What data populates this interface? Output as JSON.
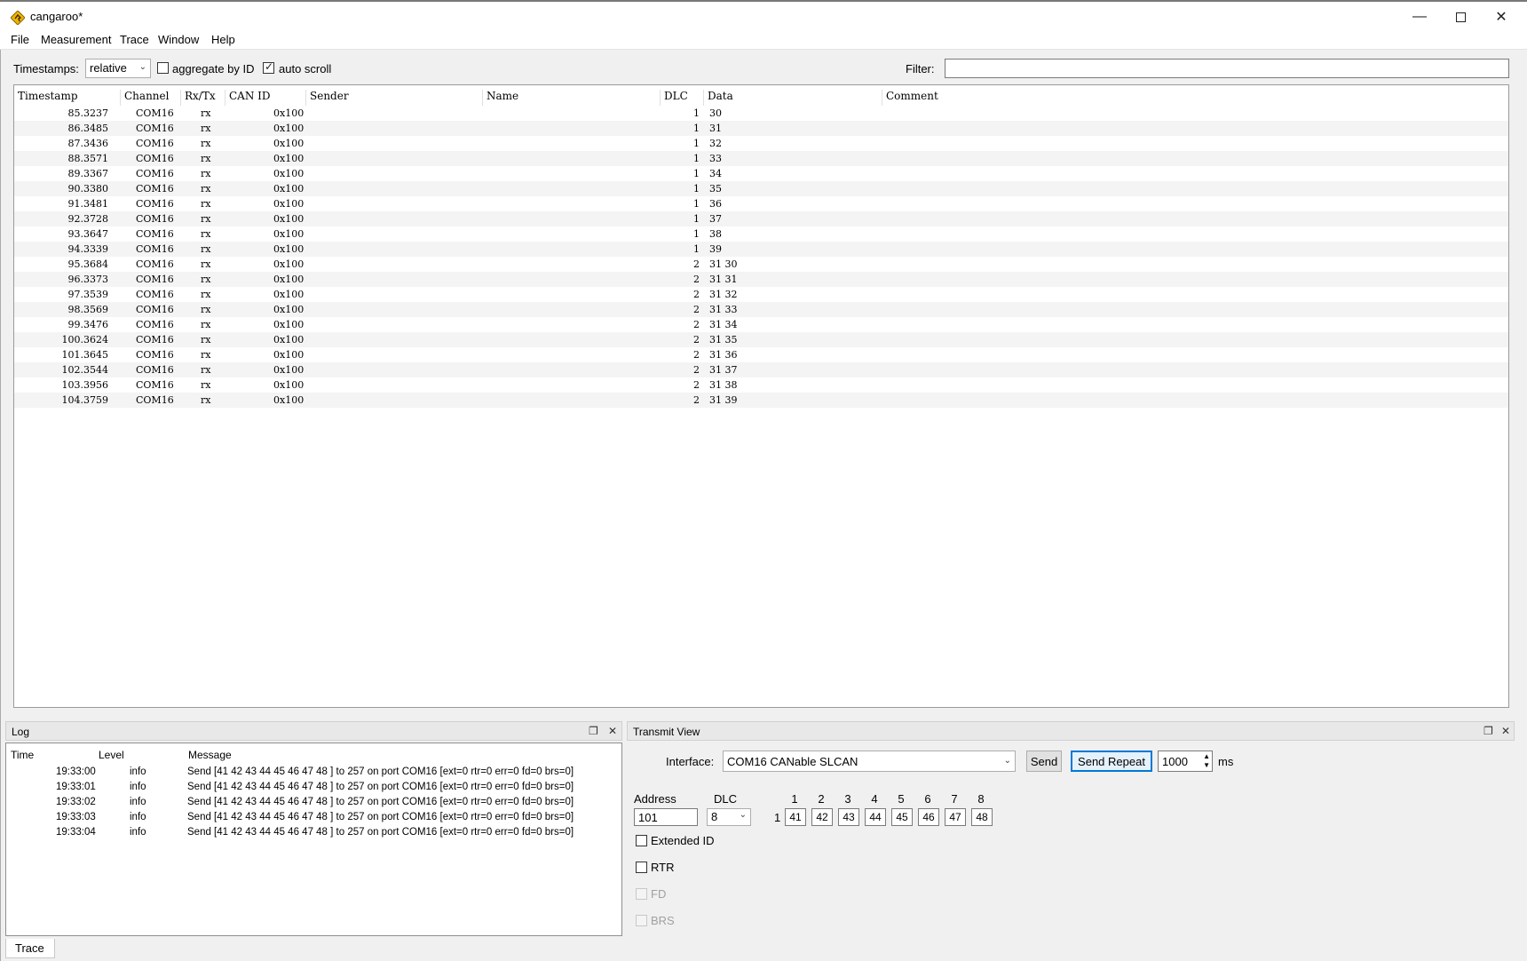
{
  "window": {
    "title": "cangaroo*",
    "controls": [
      "minimize",
      "maximize",
      "close"
    ]
  },
  "menu": [
    "File",
    "Measurement",
    "Trace",
    "Window",
    "Help"
  ],
  "toolbar": {
    "timestamps_label": "Timestamps:",
    "timestamps_value": "relative",
    "aggregate_label": "aggregate by ID",
    "aggregate_checked": false,
    "autoscroll_label": "auto scroll",
    "autoscroll_checked": true,
    "filter_label": "Filter:",
    "filter_value": ""
  },
  "trace": {
    "columns": [
      "Timestamp",
      "Channel",
      "Rx/Tx",
      "CAN ID",
      "Sender",
      "Name",
      "DLC",
      "Data",
      "Comment"
    ],
    "rows": [
      {
        "ts": "85.3237",
        "ch": "COM16",
        "dir": "rx",
        "id": "0x100",
        "dlc": "1",
        "data": "30"
      },
      {
        "ts": "86.3485",
        "ch": "COM16",
        "dir": "rx",
        "id": "0x100",
        "dlc": "1",
        "data": "31"
      },
      {
        "ts": "87.3436",
        "ch": "COM16",
        "dir": "rx",
        "id": "0x100",
        "dlc": "1",
        "data": "32"
      },
      {
        "ts": "88.3571",
        "ch": "COM16",
        "dir": "rx",
        "id": "0x100",
        "dlc": "1",
        "data": "33"
      },
      {
        "ts": "89.3367",
        "ch": "COM16",
        "dir": "rx",
        "id": "0x100",
        "dlc": "1",
        "data": "34"
      },
      {
        "ts": "90.3380",
        "ch": "COM16",
        "dir": "rx",
        "id": "0x100",
        "dlc": "1",
        "data": "35"
      },
      {
        "ts": "91.3481",
        "ch": "COM16",
        "dir": "rx",
        "id": "0x100",
        "dlc": "1",
        "data": "36"
      },
      {
        "ts": "92.3728",
        "ch": "COM16",
        "dir": "rx",
        "id": "0x100",
        "dlc": "1",
        "data": "37"
      },
      {
        "ts": "93.3647",
        "ch": "COM16",
        "dir": "rx",
        "id": "0x100",
        "dlc": "1",
        "data": "38"
      },
      {
        "ts": "94.3339",
        "ch": "COM16",
        "dir": "rx",
        "id": "0x100",
        "dlc": "1",
        "data": "39"
      },
      {
        "ts": "95.3684",
        "ch": "COM16",
        "dir": "rx",
        "id": "0x100",
        "dlc": "2",
        "data": "31 30"
      },
      {
        "ts": "96.3373",
        "ch": "COM16",
        "dir": "rx",
        "id": "0x100",
        "dlc": "2",
        "data": "31 31"
      },
      {
        "ts": "97.3539",
        "ch": "COM16",
        "dir": "rx",
        "id": "0x100",
        "dlc": "2",
        "data": "31 32"
      },
      {
        "ts": "98.3569",
        "ch": "COM16",
        "dir": "rx",
        "id": "0x100",
        "dlc": "2",
        "data": "31 33"
      },
      {
        "ts": "99.3476",
        "ch": "COM16",
        "dir": "rx",
        "id": "0x100",
        "dlc": "2",
        "data": "31 34"
      },
      {
        "ts": "100.3624",
        "ch": "COM16",
        "dir": "rx",
        "id": "0x100",
        "dlc": "2",
        "data": "31 35"
      },
      {
        "ts": "101.3645",
        "ch": "COM16",
        "dir": "rx",
        "id": "0x100",
        "dlc": "2",
        "data": "31 36"
      },
      {
        "ts": "102.3544",
        "ch": "COM16",
        "dir": "rx",
        "id": "0x100",
        "dlc": "2",
        "data": "31 37"
      },
      {
        "ts": "103.3956",
        "ch": "COM16",
        "dir": "rx",
        "id": "0x100",
        "dlc": "2",
        "data": "31 38"
      },
      {
        "ts": "104.3759",
        "ch": "COM16",
        "dir": "rx",
        "id": "0x100",
        "dlc": "2",
        "data": "31 39"
      }
    ]
  },
  "log": {
    "title": "Log",
    "columns": [
      "Time",
      "Level",
      "Message"
    ],
    "rows": [
      {
        "time": "19:33:00",
        "level": "info",
        "msg": "Send [41 42 43 44 45 46 47 48 ] to 257 on port COM16 [ext=0 rtr=0 err=0 fd=0 brs=0]"
      },
      {
        "time": "19:33:01",
        "level": "info",
        "msg": "Send [41 42 43 44 45 46 47 48 ] to 257 on port COM16 [ext=0 rtr=0 err=0 fd=0 brs=0]"
      },
      {
        "time": "19:33:02",
        "level": "info",
        "msg": "Send [41 42 43 44 45 46 47 48 ] to 257 on port COM16 [ext=0 rtr=0 err=0 fd=0 brs=0]"
      },
      {
        "time": "19:33:03",
        "level": "info",
        "msg": "Send [41 42 43 44 45 46 47 48 ] to 257 on port COM16 [ext=0 rtr=0 err=0 fd=0 brs=0]"
      },
      {
        "time": "19:33:04",
        "level": "info",
        "msg": "Send [41 42 43 44 45 46 47 48 ] to 257 on port COM16 [ext=0 rtr=0 err=0 fd=0 brs=0]"
      }
    ]
  },
  "transmit": {
    "title": "Transmit View",
    "interface_label": "Interface:",
    "interface_value": "COM16 CANable SLCAN",
    "send_label": "Send",
    "send_repeat_label": "Send Repeat",
    "interval_value": "1000",
    "interval_unit": "ms",
    "address_label": "Address",
    "address_value": "101",
    "dlc_label": "DLC",
    "dlc_value": "8",
    "row_label": "1",
    "byte_labels": [
      "1",
      "2",
      "3",
      "4",
      "5",
      "6",
      "7",
      "8"
    ],
    "bytes": [
      "41",
      "42",
      "43",
      "44",
      "45",
      "46",
      "47",
      "48"
    ],
    "extended_id_label": "Extended ID",
    "rtr_label": "RTR",
    "fd_label": "FD",
    "brs_label": "BRS"
  },
  "bottom_tab": "Trace"
}
